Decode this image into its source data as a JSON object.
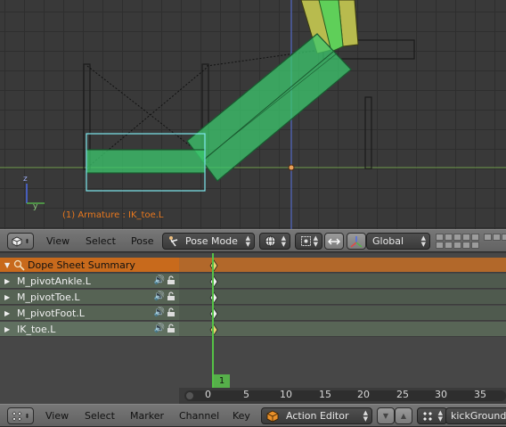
{
  "viewport": {
    "object_label": "(1) Armature : IK_toe.L",
    "axis_labels": {
      "z": "z",
      "y": "y"
    }
  },
  "viewport_header": {
    "editor_icon": "3d-view-icon",
    "menus": [
      "View",
      "Select",
      "Pose"
    ],
    "mode": {
      "label": "Pose Mode",
      "icon": "pose-mode-icon"
    },
    "shading_icon": "shading-sphere-icon",
    "pivot_icon": "pivot-point-icon",
    "manipulator_icon": "manipulator-icon",
    "transform_orientation": "Global",
    "layers": "layer-grid"
  },
  "dopesheet": {
    "channels": [
      {
        "label": "Dope Sheet Summary",
        "type": "summary",
        "icon": "action-icon"
      },
      {
        "label": "M_pivotAnkle.L",
        "type": "bone"
      },
      {
        "label": "M_pivotToe.L",
        "type": "bone"
      },
      {
        "label": "M_pivotFoot.L",
        "type": "bone"
      },
      {
        "label": "IK_toe.L",
        "type": "bone"
      }
    ],
    "keyframe_frame": 1,
    "current_frame": "1",
    "timeline_ticks": [
      "0",
      "5",
      "10",
      "15",
      "20",
      "25",
      "30",
      "35"
    ]
  },
  "editor_header": {
    "editor_icon": "dope-sheet-icon",
    "menus": [
      "View",
      "Select",
      "Marker",
      "Channel",
      "Key"
    ],
    "mode": {
      "label": "Action Editor",
      "icon": "action-editor-icon"
    },
    "action_name": "kickGround"
  },
  "colors": {
    "bone_fill": "#3cc86e",
    "bone_outline": "#1a5a30",
    "selection_outline": "#7ee8ee",
    "summary_orange": "#c86a1c",
    "playhead_green": "#55c246",
    "keyframe": "#e8d070"
  }
}
